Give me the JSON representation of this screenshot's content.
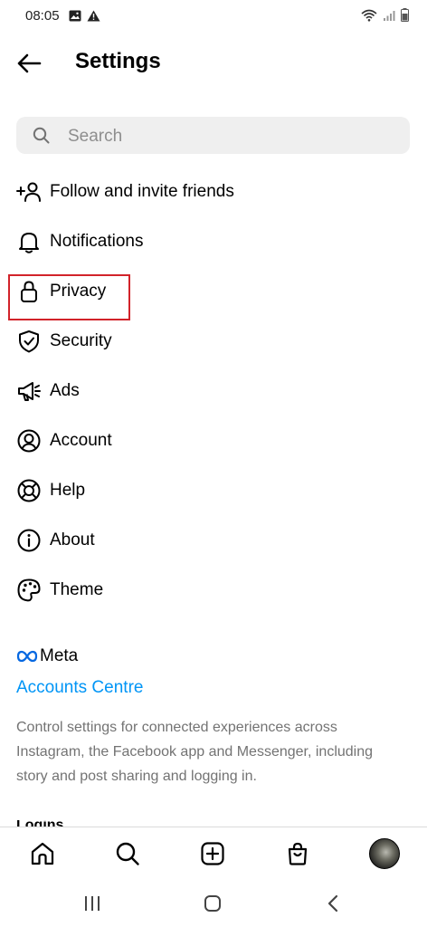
{
  "status_bar": {
    "time": "08:05",
    "left_icons": [
      "gallery-icon",
      "alert-icon"
    ],
    "right_icons": [
      "wifi-icon",
      "signal-icon",
      "battery-icon"
    ]
  },
  "header": {
    "title": "Settings",
    "back_icon": "arrow-left-icon"
  },
  "search": {
    "placeholder": "Search",
    "value": ""
  },
  "menu": {
    "items": [
      {
        "label": "Follow and invite friends",
        "icon": "add-person-icon"
      },
      {
        "label": "Notifications",
        "icon": "bell-icon"
      },
      {
        "label": "Privacy",
        "icon": "lock-icon",
        "highlighted": true
      },
      {
        "label": "Security",
        "icon": "shield-icon"
      },
      {
        "label": "Ads",
        "icon": "megaphone-icon"
      },
      {
        "label": "Account",
        "icon": "account-circle-icon"
      },
      {
        "label": "Help",
        "icon": "lifebuoy-icon"
      },
      {
        "label": "About",
        "icon": "info-icon"
      },
      {
        "label": "Theme",
        "icon": "palette-icon"
      }
    ]
  },
  "meta": {
    "logo_text": "Meta",
    "accounts_centre": "Accounts Centre",
    "description": "Control settings for connected experiences across Instagram, the Facebook app and Messenger, including story and post sharing and logging in."
  },
  "partial_section_text": "Logins",
  "tab_bar": {
    "icons": [
      "home-icon",
      "search-icon",
      "create-icon",
      "shop-icon",
      "profile-avatar"
    ]
  },
  "nav_bar": {
    "icons": [
      "recent-apps-icon",
      "home-circle-icon",
      "back-chevron-icon"
    ]
  },
  "colors": {
    "accent": "#0095f6",
    "highlight_box": "#d2232a",
    "search_bg": "#efefef",
    "secondary_text": "#737373"
  }
}
